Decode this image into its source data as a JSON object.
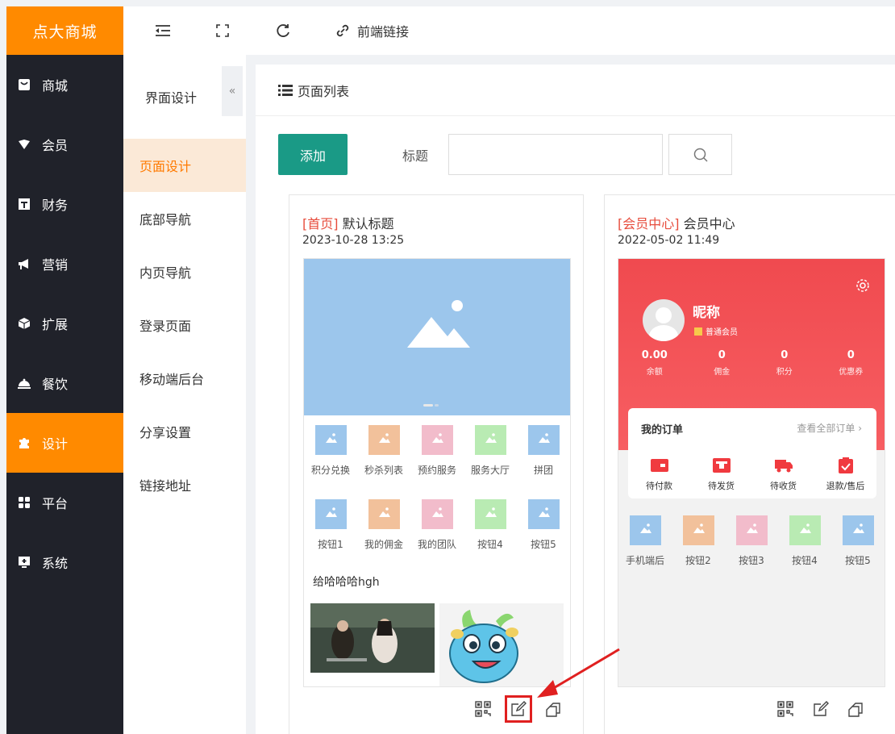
{
  "sidebar": {
    "brand": "点大商城",
    "items": [
      {
        "label": "商城",
        "icon": "store-icon"
      },
      {
        "label": "会员",
        "icon": "member-icon"
      },
      {
        "label": "财务",
        "icon": "finance-icon"
      },
      {
        "label": "营销",
        "icon": "megaphone-icon"
      },
      {
        "label": "扩展",
        "icon": "cube-icon"
      },
      {
        "label": "餐饮",
        "icon": "dining-icon"
      },
      {
        "label": "设计",
        "icon": "puzzle-icon"
      },
      {
        "label": "平台",
        "icon": "platform-icon"
      },
      {
        "label": "系统",
        "icon": "system-icon"
      }
    ],
    "active_index": 6
  },
  "topbar": {
    "link_label": "前端链接"
  },
  "subnav": {
    "title": "界面设计",
    "collapse": "«",
    "items": [
      "页面设计",
      "底部导航",
      "内页导航",
      "登录页面",
      "移动端后台",
      "分享设置",
      "链接地址"
    ],
    "active_index": 0
  },
  "main": {
    "title": "页面列表",
    "add_label": "添加",
    "field_label": "标题",
    "search_value": ""
  },
  "cards": [
    {
      "tag": "[首页]",
      "title": "默认标题",
      "time": "2023-10-28 13:25",
      "row1": [
        "积分兑换",
        "秒杀列表",
        "预约服务",
        "服务大厅",
        "拼团"
      ],
      "row2": [
        "按钮1",
        "我的佣金",
        "我的团队",
        "按钮4",
        "按钮5"
      ],
      "section_title": "给哈哈哈hgh"
    },
    {
      "tag": "[会员中心]",
      "title": "会员中心",
      "time": "2022-05-02 11:49",
      "profile": {
        "nickname": "昵称",
        "level": "普通会员",
        "stats": [
          {
            "value": "0.00",
            "label": "余额"
          },
          {
            "value": "0",
            "label": "佣金"
          },
          {
            "value": "0",
            "label": "积分"
          },
          {
            "value": "0",
            "label": "优惠券"
          }
        ]
      },
      "orders": {
        "title": "我的订单",
        "view_all": "查看全部订单",
        "items": [
          "待付款",
          "待发货",
          "待收货",
          "退款/售后"
        ]
      },
      "row1": [
        "手机端后",
        "按钮2",
        "按钮3",
        "按钮4",
        "按钮5"
      ]
    }
  ],
  "colors": {
    "accent": "#ff8a00",
    "primary": "#1a9a86",
    "member_red": "#f5474c",
    "tile_colors": [
      "#9cc6ec",
      "#f2c19b",
      "#f2bccb",
      "#b9ebb3",
      "#9cc6ec"
    ]
  }
}
